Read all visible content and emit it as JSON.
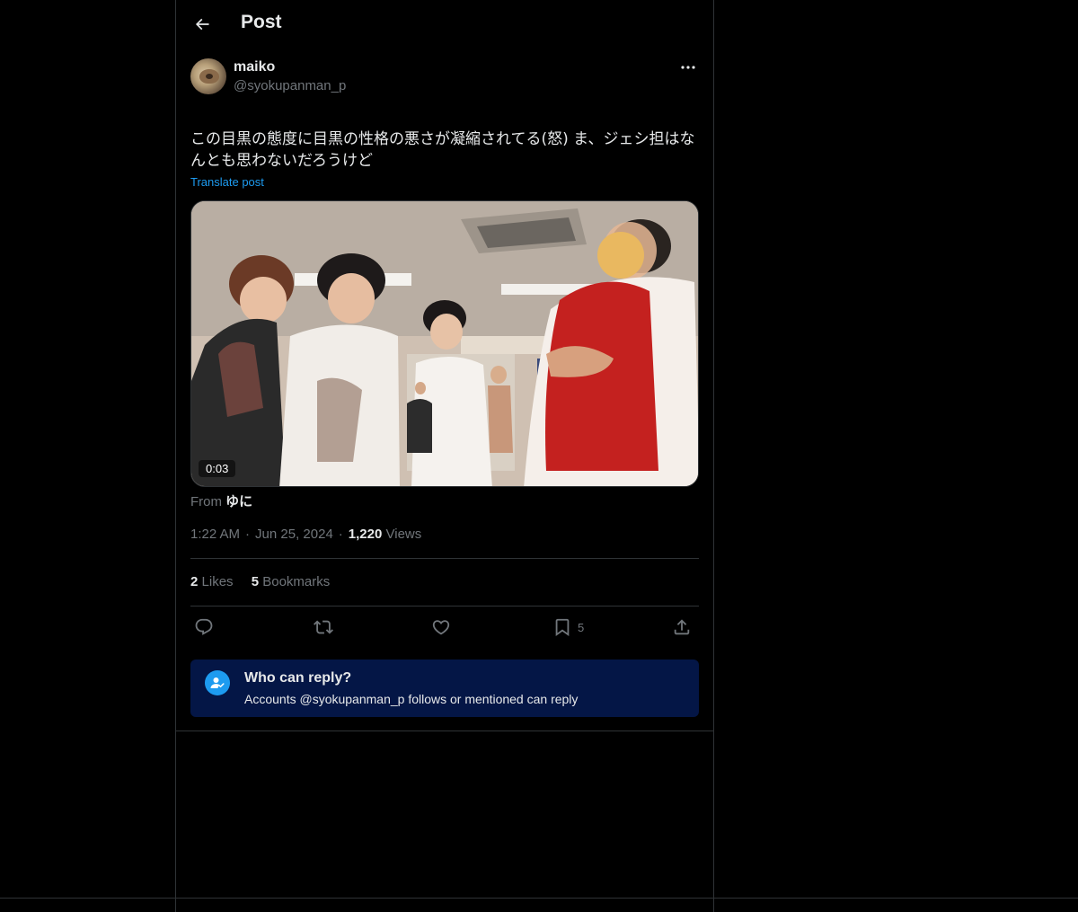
{
  "header": {
    "title": "Post",
    "back_icon": "arrow-left-icon"
  },
  "author": {
    "display_name": "maiko",
    "handle": "@syokupanman_p",
    "more_icon": "ellipsis-icon"
  },
  "post": {
    "text": "この目黒の態度に目黒の性格の悪さが凝縮されてる(怒) ま、ジェシ担はなんとも思わないだろうけど",
    "translate_label": "Translate post",
    "media": {
      "type": "video",
      "duration": "0:03"
    },
    "source_prefix": "From",
    "source_name": "ゆに",
    "time": "1:22 AM",
    "date": "Jun 25, 2024",
    "views_count": "1,220",
    "views_label": "Views"
  },
  "stats": {
    "likes_count": "2",
    "likes_label": "Likes",
    "bookmarks_count": "5",
    "bookmarks_label": "Bookmarks"
  },
  "actions": {
    "reply_icon": "reply-icon",
    "repost_icon": "repost-icon",
    "like_icon": "heart-icon",
    "bookmark_icon": "bookmark-icon",
    "bookmark_count": "5",
    "share_icon": "share-icon"
  },
  "reply_settings": {
    "title": "Who can reply?",
    "subtitle": "Accounts @syokupanman_p follows or mentioned can reply",
    "icon": "user-check-icon"
  },
  "colors": {
    "accent": "#1d9bf0",
    "reply_box_bg": "#041646",
    "muted": "#71767b",
    "text": "#e7e9ea",
    "border": "#2f3336"
  }
}
